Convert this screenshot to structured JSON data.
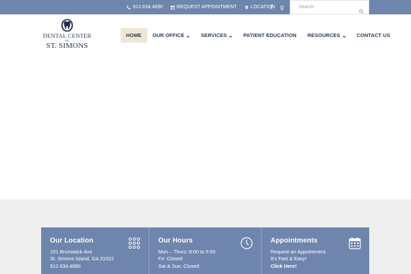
{
  "topbar": {
    "phone": "912.634.4890",
    "request": "REQUEST APPOINTMENT",
    "location": "LOCATION",
    "social_facebook": "f",
    "social_google": "g",
    "search_placeholder": "Search"
  },
  "logo": {
    "line1": "DENTAL CENTER",
    "line2": "OF",
    "line3": "ST. SIMONS"
  },
  "nav": {
    "items": [
      {
        "label": "HOME"
      },
      {
        "label": "OUR OFFICE"
      },
      {
        "label": "SERVICES"
      },
      {
        "label": "PATIENT EDUCATION"
      },
      {
        "label": "RESOURCES"
      },
      {
        "label": "CONTACT US"
      }
    ]
  },
  "panels": {
    "location": {
      "title": "Our Location",
      "lines": [
        "101 Brunswick Ave",
        "St. Simons Island, GA 31522",
        "912.634.4890"
      ]
    },
    "hours": {
      "title": "Our Hours",
      "lines": [
        "Mon – Thurs:  8:00 to 5:00",
        "Fri:  Closed",
        "Sat & Sun:  Closed"
      ]
    },
    "appointments": {
      "title": "Appointments",
      "lines": [
        "Request an Appointment.",
        "It's Fast & Easy!"
      ],
      "link": "Click Here!"
    }
  },
  "colors": {
    "topbar": "#6e86ad",
    "nav_active_bg": "#ede6d3",
    "nav_text": "#2c3a55",
    "panel_bg": "#6e86ad",
    "band_bg": "#efefef"
  }
}
